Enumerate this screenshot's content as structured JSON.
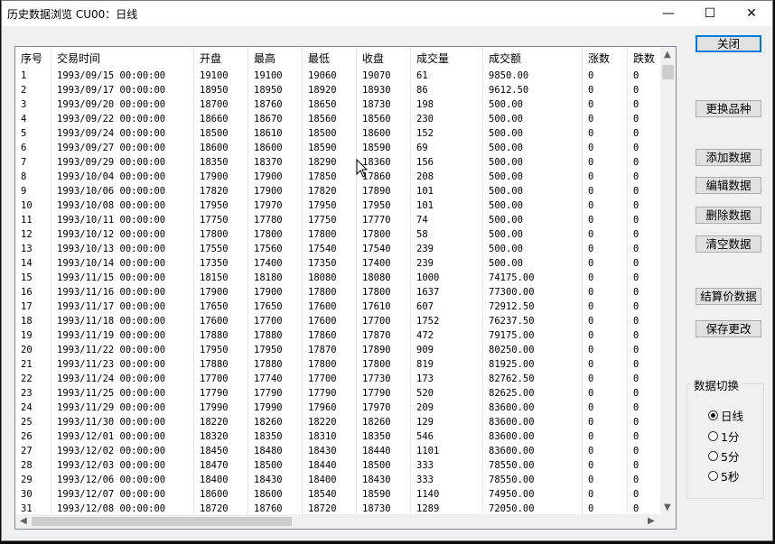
{
  "window": {
    "title": "历史数据浏览 CU00：日线",
    "minimize_glyph": "—",
    "maximize_glyph": "☐",
    "close_glyph": "✕"
  },
  "table": {
    "columns": [
      "序号",
      "交易时间",
      "开盘",
      "最高",
      "最低",
      "收盘",
      "成交量",
      "成交额",
      "涨数",
      "跌数"
    ],
    "rows": [
      [
        "1",
        "1993/09/15 00:00:00",
        "19100",
        "19100",
        "19060",
        "19070",
        "61",
        "9850.00",
        "0",
        "0"
      ],
      [
        "2",
        "1993/09/17 00:00:00",
        "18950",
        "18950",
        "18920",
        "18930",
        "86",
        "9612.50",
        "0",
        "0"
      ],
      [
        "3",
        "1993/09/20 00:00:00",
        "18700",
        "18760",
        "18650",
        "18730",
        "198",
        "500.00",
        "0",
        "0"
      ],
      [
        "4",
        "1993/09/22 00:00:00",
        "18660",
        "18670",
        "18560",
        "18560",
        "230",
        "500.00",
        "0",
        "0"
      ],
      [
        "5",
        "1993/09/24 00:00:00",
        "18500",
        "18610",
        "18500",
        "18600",
        "152",
        "500.00",
        "0",
        "0"
      ],
      [
        "6",
        "1993/09/27 00:00:00",
        "18600",
        "18600",
        "18590",
        "18590",
        "69",
        "500.00",
        "0",
        "0"
      ],
      [
        "7",
        "1993/09/29 00:00:00",
        "18350",
        "18370",
        "18290",
        "18360",
        "156",
        "500.00",
        "0",
        "0"
      ],
      [
        "8",
        "1993/10/04 00:00:00",
        "17900",
        "17900",
        "17850",
        "17860",
        "208",
        "500.00",
        "0",
        "0"
      ],
      [
        "9",
        "1993/10/06 00:00:00",
        "17820",
        "17900",
        "17820",
        "17890",
        "101",
        "500.00",
        "0",
        "0"
      ],
      [
        "10",
        "1993/10/08 00:00:00",
        "17950",
        "17970",
        "17950",
        "17950",
        "101",
        "500.00",
        "0",
        "0"
      ],
      [
        "11",
        "1993/10/11 00:00:00",
        "17750",
        "17780",
        "17750",
        "17770",
        "74",
        "500.00",
        "0",
        "0"
      ],
      [
        "12",
        "1993/10/12 00:00:00",
        "17800",
        "17800",
        "17800",
        "17800",
        "58",
        "500.00",
        "0",
        "0"
      ],
      [
        "13",
        "1993/10/13 00:00:00",
        "17550",
        "17560",
        "17540",
        "17540",
        "239",
        "500.00",
        "0",
        "0"
      ],
      [
        "14",
        "1993/10/14 00:00:00",
        "17350",
        "17400",
        "17350",
        "17400",
        "239",
        "500.00",
        "0",
        "0"
      ],
      [
        "15",
        "1993/11/15 00:00:00",
        "18150",
        "18180",
        "18080",
        "18080",
        "1000",
        "74175.00",
        "0",
        "0"
      ],
      [
        "16",
        "1993/11/16 00:00:00",
        "17900",
        "17900",
        "17800",
        "17800",
        "1637",
        "77300.00",
        "0",
        "0"
      ],
      [
        "17",
        "1993/11/17 00:00:00",
        "17650",
        "17650",
        "17600",
        "17610",
        "607",
        "72912.50",
        "0",
        "0"
      ],
      [
        "18",
        "1993/11/18 00:00:00",
        "17600",
        "17700",
        "17600",
        "17700",
        "1752",
        "76237.50",
        "0",
        "0"
      ],
      [
        "19",
        "1993/11/19 00:00:00",
        "17880",
        "17880",
        "17860",
        "17870",
        "472",
        "79175.00",
        "0",
        "0"
      ],
      [
        "20",
        "1993/11/22 00:00:00",
        "17950",
        "17950",
        "17870",
        "17890",
        "909",
        "80250.00",
        "0",
        "0"
      ],
      [
        "21",
        "1993/11/23 00:00:00",
        "17880",
        "17880",
        "17800",
        "17800",
        "819",
        "81925.00",
        "0",
        "0"
      ],
      [
        "22",
        "1993/11/24 00:00:00",
        "17700",
        "17740",
        "17700",
        "17730",
        "173",
        "82762.50",
        "0",
        "0"
      ],
      [
        "23",
        "1993/11/25 00:00:00",
        "17790",
        "17790",
        "17790",
        "17790",
        "520",
        "82625.00",
        "0",
        "0"
      ],
      [
        "24",
        "1993/11/29 00:00:00",
        "17990",
        "17990",
        "17960",
        "17970",
        "209",
        "83600.00",
        "0",
        "0"
      ],
      [
        "25",
        "1993/11/30 00:00:00",
        "18220",
        "18260",
        "18220",
        "18260",
        "129",
        "83600.00",
        "0",
        "0"
      ],
      [
        "26",
        "1993/12/01 00:00:00",
        "18320",
        "18350",
        "18310",
        "18350",
        "546",
        "83600.00",
        "0",
        "0"
      ],
      [
        "27",
        "1993/12/02 00:00:00",
        "18450",
        "18480",
        "18430",
        "18440",
        "1101",
        "83600.00",
        "0",
        "0"
      ],
      [
        "28",
        "1993/12/03 00:00:00",
        "18470",
        "18500",
        "18440",
        "18500",
        "333",
        "78550.00",
        "0",
        "0"
      ],
      [
        "29",
        "1993/12/06 00:00:00",
        "18400",
        "18430",
        "18400",
        "18430",
        "333",
        "78550.00",
        "0",
        "0"
      ],
      [
        "30",
        "1993/12/07 00:00:00",
        "18600",
        "18600",
        "18540",
        "18590",
        "1140",
        "74950.00",
        "0",
        "0"
      ],
      [
        "31",
        "1993/12/08 00:00:00",
        "18720",
        "18760",
        "18720",
        "18730",
        "1289",
        "72050.00",
        "0",
        "0"
      ]
    ]
  },
  "buttons": {
    "close": "关闭",
    "change_product": "更换品种",
    "add_data": "添加数据",
    "edit_data": "编辑数据",
    "delete_data": "删除数据",
    "clear_data": "清空数据",
    "settlement_data": "结算价数据",
    "save_changes": "保存更改"
  },
  "data_switch": {
    "label": "数据切换",
    "options": [
      {
        "label": "日线",
        "selected": true
      },
      {
        "label": "1分",
        "selected": false
      },
      {
        "label": "5分",
        "selected": false
      },
      {
        "label": "5秒",
        "selected": false
      }
    ]
  }
}
